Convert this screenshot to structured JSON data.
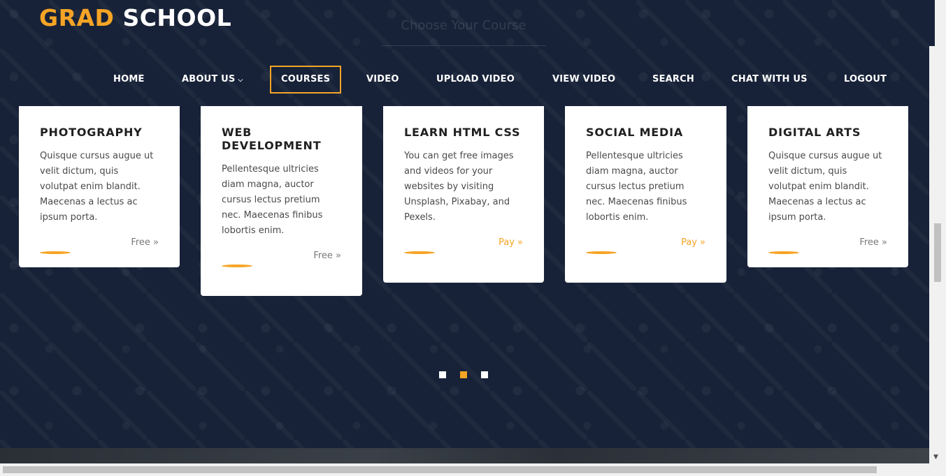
{
  "logo": {
    "accent": "GRAD",
    "rest": "SCHOOL"
  },
  "search": {
    "placeholder": "Choose Your Course"
  },
  "nav": {
    "home": "HOME",
    "about": "ABOUT US",
    "courses": "COURSES",
    "video": "VIDEO",
    "upload_video": "UPLOAD VIDEO",
    "view_video": "VIEW VIDEO",
    "search": "SEARCH",
    "chat": "CHAT WITH US",
    "logout": "LOGOUT"
  },
  "cards": [
    {
      "title": "PHOTOGRAPHY",
      "text": "Quisque cursus augue ut velit dictum, quis volutpat enim blandit. Maecenas a lectus ac ipsum porta.",
      "price": "Free »"
    },
    {
      "title": "WEB DEVELOPMENT",
      "text": "Pellentesque ultricies diam magna, auctor cursus lectus pretium nec. Maecenas finibus lobortis enim.",
      "price": "Free »"
    },
    {
      "title": "LEARN HTML CSS",
      "text": "You can get free images and videos for your websites by visiting Unsplash, Pixabay, and Pexels.",
      "price": "Pay »"
    },
    {
      "title": "SOCIAL MEDIA",
      "text": "Pellentesque ultricies diam magna, auctor cursus lectus pretium nec. Maecenas finibus lobortis enim.",
      "price": "Pay »"
    },
    {
      "title": "DIGITAL ARTS",
      "text": "Quisque cursus augue ut velit dictum, quis volutpat enim blandit. Maecenas a lectus ac ipsum porta.",
      "price": "Free »"
    }
  ],
  "carousel": {
    "active_dot": 2,
    "dot_count": 3
  },
  "colors": {
    "accent": "#f5a425",
    "background": "#172238"
  }
}
